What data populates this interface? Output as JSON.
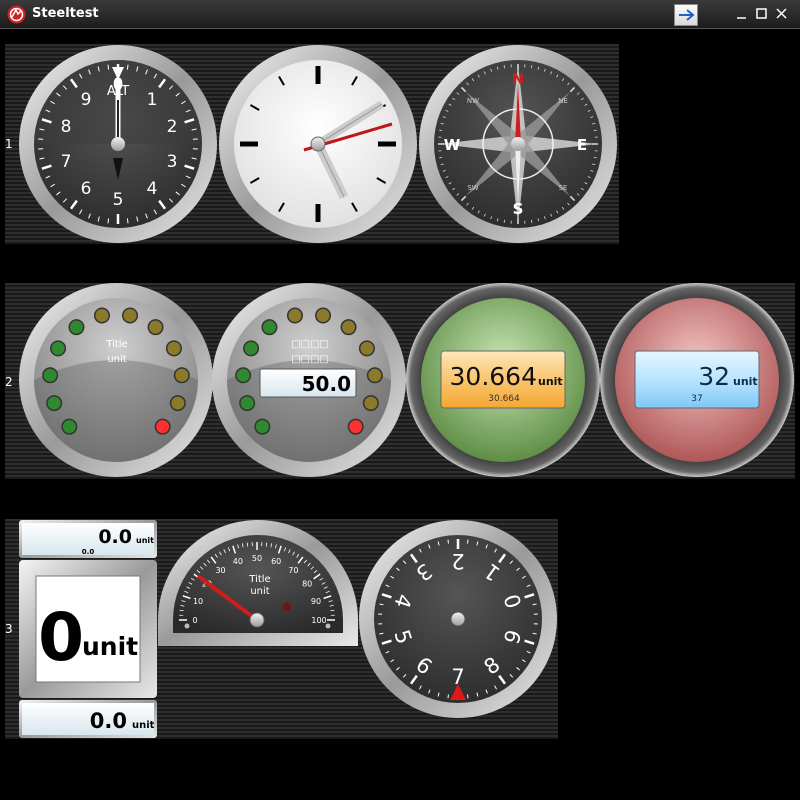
{
  "window": {
    "title": "Steeltest"
  },
  "rows": {
    "row1_label": "1",
    "row2_label": "2",
    "row3_label": "3"
  },
  "row1": {
    "altimeter": {
      "numbers": [
        "0",
        "1",
        "2",
        "3",
        "4",
        "5",
        "6",
        "7",
        "8",
        "9"
      ],
      "label": "ALT"
    },
    "clock": {},
    "compass": {
      "north": "N",
      "east": "E",
      "south": "S",
      "west": "W",
      "ne": "NE",
      "se": "SE",
      "sw": "SW",
      "nw": "NW"
    }
  },
  "row2": {
    "led_gauge_1": {
      "title": "Title",
      "unit": "unit"
    },
    "led_gauge_2": {
      "value": "50.0",
      "placeholder": "□□□□"
    },
    "lcd_green": {
      "value": "30.664",
      "unit": "unit",
      "sub": "30.664"
    },
    "lcd_red": {
      "value": "32",
      "unit": "unit",
      "sub": "37"
    }
  },
  "row3": {
    "lcd_top": {
      "value": "0.0",
      "unit": "unit",
      "sub": "0.0"
    },
    "big_display": {
      "value": "0",
      "unit": "unit"
    },
    "lcd_bottom": {
      "value": "0.0",
      "unit": "unit"
    },
    "radial_half": {
      "title": "Title",
      "unit": "unit",
      "ticks": [
        "0",
        "10",
        "20",
        "30",
        "40",
        "50",
        "60",
        "70",
        "80",
        "90",
        "100"
      ]
    },
    "odometer": {
      "numbers": [
        "0",
        "1",
        "2",
        "3",
        "4",
        "5",
        "6",
        "7",
        "8",
        "9"
      ]
    }
  },
  "colors": {
    "accent_red": "#d01c1c",
    "lcd_green_bg": "#f9c570",
    "lcd_blue_bg": "#b8e4ff"
  }
}
